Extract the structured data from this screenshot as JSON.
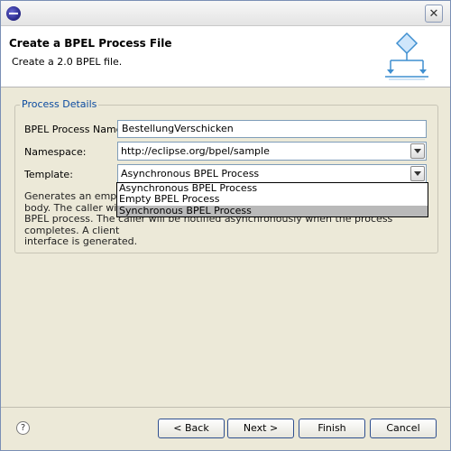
{
  "window": {
    "title": "",
    "close_glyph": "✕",
    "app_icon": "eclipse-icon"
  },
  "header": {
    "title": "Create a BPEL Process File",
    "description": "Create a 2.0 BPEL file.",
    "icon": "bpel-process-diagram-icon"
  },
  "group": {
    "legend": "Process Details",
    "process_name_label": "BPEL Process Name:",
    "process_name_value": "BestellungVerschicken",
    "namespace_label": "Namespace:",
    "namespace_value": "http://eclipse.org/bpel/sample",
    "template_label": "Template:",
    "template_value": "Asynchronous BPEL Process",
    "template_options": [
      "Asynchronous BPEL Process",
      "Empty BPEL Process",
      "Synchronous BPEL Process"
    ],
    "template_highlighted_index": 2,
    "description_lines": [
      "Generates an empty B",
      "body. The caller will re",
      "BPEL process. The caller will be notified asynchronously when the process completes. A client",
      "interface is generated."
    ]
  },
  "buttons": {
    "help": "?",
    "back": "< Back",
    "next": "Next >",
    "finish": "Finish",
    "cancel": "Cancel"
  },
  "colors": {
    "legend": "#0a4aa0",
    "dialog_background": "#ece9d8",
    "button_border": "#2f4f8f",
    "dropdown_highlight": "#b9b9b9"
  }
}
